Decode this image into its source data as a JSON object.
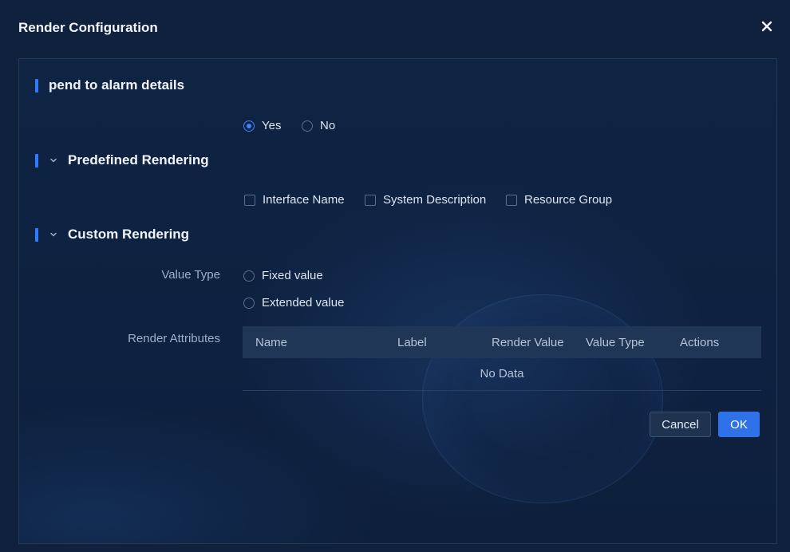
{
  "dialog": {
    "title": "Render Configuration"
  },
  "sections": {
    "append": {
      "title": "pend to alarm details",
      "options": [
        "Yes",
        "No"
      ],
      "selected": "Yes"
    },
    "predefined": {
      "title": "Predefined Rendering",
      "options": [
        "Interface Name",
        "System Description",
        "Resource Group"
      ]
    },
    "custom": {
      "title": "Custom Rendering",
      "value_type_label": "Value Type",
      "value_type_options": [
        "Fixed value",
        "Extended value"
      ],
      "render_attributes_label": "Render Attributes"
    }
  },
  "table": {
    "columns": [
      "Name",
      "Label",
      "Render Value",
      "Value Type",
      "Actions"
    ],
    "empty_text": "No Data"
  },
  "footer": {
    "cancel_label": "Cancel",
    "ok_label": "OK"
  },
  "colors": {
    "accent": "#2f7bff",
    "primary_button": "#2f72e8",
    "background": "#10213d"
  },
  "icons": {
    "close": "close-icon",
    "chevron": "chevron-down-icon"
  }
}
